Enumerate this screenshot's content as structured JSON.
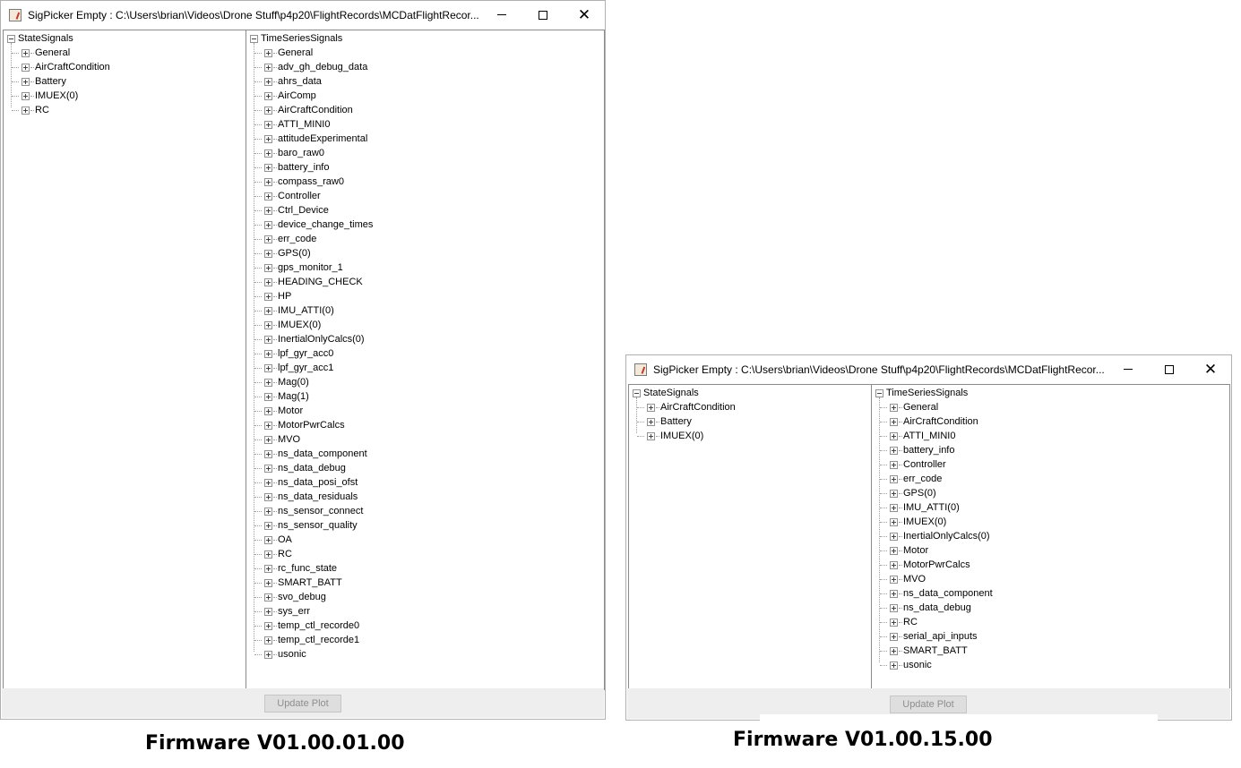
{
  "window_1": {
    "title": "SigPicker Empty : C:\\Users\\brian\\Videos\\Drone Stuff\\p4p20\\FlightRecords\\MCDatFlightRecor...",
    "state_root": "StateSignals",
    "state_items": [
      "General",
      "AirCraftCondition",
      "Battery",
      "IMUEX(0)",
      "RC"
    ],
    "time_root": "TimeSeriesSignals",
    "time_items": [
      "General",
      "adv_gh_debug_data",
      "ahrs_data",
      "AirComp",
      "AirCraftCondition",
      "ATTI_MINI0",
      "attitudeExperimental",
      "baro_raw0",
      "battery_info",
      "compass_raw0",
      "Controller",
      "Ctrl_Device",
      "device_change_times",
      "err_code",
      "GPS(0)",
      "gps_monitor_1",
      "HEADING_CHECK",
      "HP",
      "IMU_ATTI(0)",
      "IMUEX(0)",
      "InertialOnlyCalcs(0)",
      "lpf_gyr_acc0",
      "lpf_gyr_acc1",
      "Mag(0)",
      "Mag(1)",
      "Motor",
      "MotorPwrCalcs",
      "MVO",
      "ns_data_component",
      "ns_data_debug",
      "ns_data_posi_ofst",
      "ns_data_residuals",
      "ns_sensor_connect",
      "ns_sensor_quality",
      "OA",
      "RC",
      "rc_func_state",
      "SMART_BATT",
      "svo_debug",
      "sys_err",
      "temp_ctl_recorde0",
      "temp_ctl_recorde1",
      "usonic"
    ],
    "button_label": "Update Plot"
  },
  "window_2": {
    "title": "SigPicker Empty : C:\\Users\\brian\\Videos\\Drone Stuff\\p4p20\\FlightRecords\\MCDatFlightRecor...",
    "state_root": "StateSignals",
    "state_items": [
      "AirCraftCondition",
      "Battery",
      "IMUEX(0)"
    ],
    "time_root": "TimeSeriesSignals",
    "time_items": [
      "General",
      "AirCraftCondition",
      "ATTI_MINI0",
      "battery_info",
      "Controller",
      "err_code",
      "GPS(0)",
      "IMU_ATTI(0)",
      "IMUEX(0)",
      "InertialOnlyCalcs(0)",
      "Motor",
      "MotorPwrCalcs",
      "MVO",
      "ns_data_component",
      "ns_data_debug",
      "RC",
      "serial_api_inputs",
      "SMART_BATT",
      "usonic"
    ],
    "button_label": "Update Plot"
  },
  "captions": {
    "left": "Firmware V01.00.01.00",
    "right": "Firmware V01.00.15.00"
  },
  "icons": {
    "window_icon": "java-cup-icon",
    "minimize": "minimize-icon",
    "maximize": "maximize-icon",
    "close": "close-icon",
    "collapse": "tree-collapse-icon",
    "expand": "tree-expand-icon"
  }
}
